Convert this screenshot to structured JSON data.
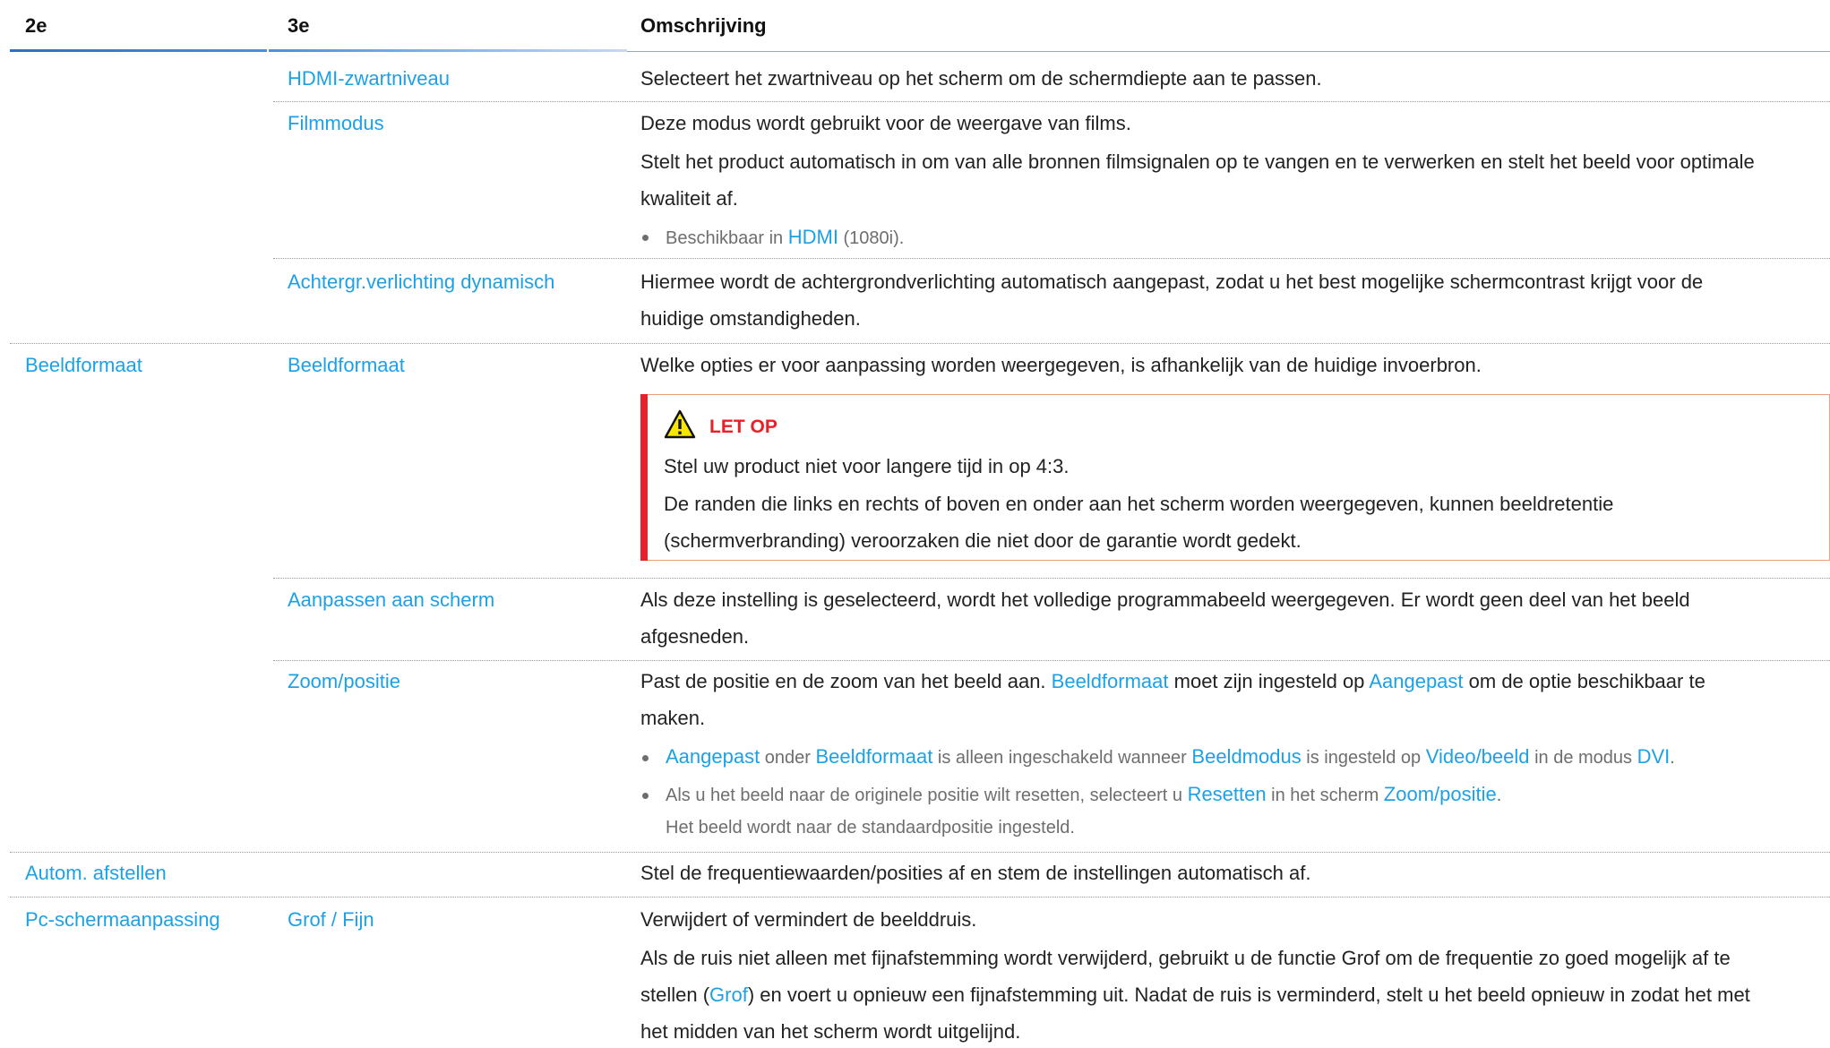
{
  "header": {
    "col1": "2e",
    "col2": "3e",
    "col3": "Omschrijving"
  },
  "rows": {
    "hdmi": {
      "col2": "HDMI-zwartniveau",
      "desc": "Selecteert het zwartniveau op het scherm om de schermdiepte aan te passen."
    },
    "film": {
      "col2": "Filmmodus",
      "desc1": "Deze modus wordt gebruikt voor de weergave van films.",
      "desc2a": "Stelt het product automatisch in om van alle bronnen filmsignalen op te vangen en te verwerken en stelt het beeld voor optimale",
      "desc2b": "kwaliteit af.",
      "note_pre": "Beschikbaar in ",
      "note_link": "HDMI",
      "note_post": " (1080i)."
    },
    "backlight": {
      "col2": "Achtergr.verlichting dynamisch",
      "desc_a": "Hiermee wordt de achtergrondverlichting automatisch aangepast, zodat u het best mogelijke schermcontrast krijgt voor de",
      "desc_b": "huidige omstandigheden."
    },
    "format": {
      "col1": "Beeldformaat",
      "col2": "Beeldformaat",
      "desc": "Welke opties er voor aanpassing worden weergegeven, is afhankelijk van de huidige invoerbron.",
      "caution": {
        "title": "LET OP",
        "line1": "Stel uw product niet voor langere tijd in op 4:3.",
        "line2a": "De randen die links en rechts of boven en onder aan het scherm worden weergegeven, kunnen beeldretentie",
        "line2b": "(schermverbranding) veroorzaken die niet door de garantie wordt gedekt."
      }
    },
    "fit": {
      "col2": "Aanpassen aan scherm",
      "desc_a": "Als deze instelling is geselecteerd, wordt het volledige programmabeeld weergegeven. Er wordt geen deel van het beeld",
      "desc_b": "afgesneden."
    },
    "zoom": {
      "col2": "Zoom/positie",
      "desc_a_1": "Past de positie en de zoom van het beeld aan. ",
      "desc_a_link1": "Beeldformaat",
      "desc_a_2": " moet zijn ingesteld op ",
      "desc_a_link2": "Aangepast",
      "desc_a_3": " om de optie beschikbaar te",
      "desc_b": "maken.",
      "note1": {
        "l1": "Aangepast",
        "t1": " onder ",
        "l2": "Beeldformaat",
        "t2": " is alleen ingeschakeld wanneer ",
        "l3": "Beeldmodus",
        "t3": " is ingesteld op ",
        "l4": "Video/beeld",
        "t4": " in de modus ",
        "l5": "DVI",
        "t5": "."
      },
      "note2": {
        "t1": "Als u het beeld naar de originele positie wilt resetten, selecteert u ",
        "l1": "Resetten",
        "t2": " in het scherm ",
        "l2": "Zoom/positie",
        "t3": "."
      },
      "note3": "Het beeld wordt naar de standaardpositie ingesteld."
    },
    "auto": {
      "col1": "Autom. afstellen",
      "desc": "Stel de frequentiewaarden/posities af en stem de instellingen automatisch af."
    },
    "pc": {
      "col1": "Pc-schermaanpassing",
      "col2": "Grof / Fijn",
      "desc1": "Verwijdert of vermindert de beelddruis.",
      "desc2a": "Als de ruis niet alleen met fijnafstemming wordt verwijderd, gebruikt u de functie Grof om de frequentie zo goed mogelijk af te",
      "desc2b_1": "stellen (",
      "desc2b_link": "Grof",
      "desc2b_2": ") en voert u opnieuw een fijnafstemming uit. Nadat de ruis is verminderd, stelt u het beeld opnieuw in zodat het met",
      "desc2c": "het midden van het scherm wordt uitgelijnd."
    }
  },
  "colors": {
    "link": "#1da1e6",
    "caution": "#e8202a",
    "text": "#222222",
    "note": "#6e6e6e"
  },
  "icons": {
    "caution": "warning-triangle-icon"
  }
}
